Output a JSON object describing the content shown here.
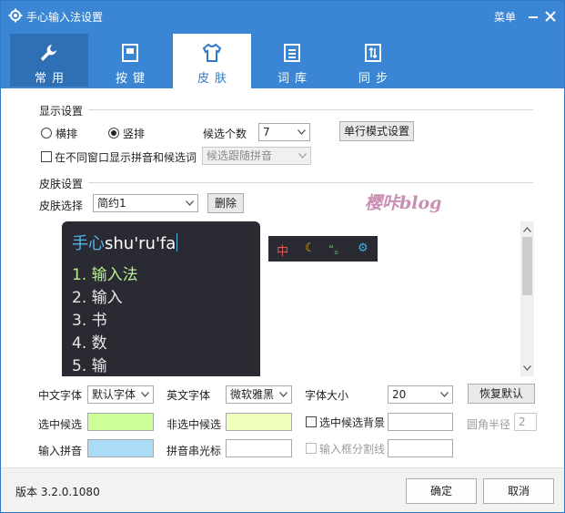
{
  "window": {
    "title": "手心输入法设置",
    "menu_label": "菜单"
  },
  "tabs": [
    {
      "label": "常用",
      "icon": "wrench-icon"
    },
    {
      "label": "按键",
      "icon": "keyboard-icon"
    },
    {
      "label": "皮肤",
      "icon": "shirt-icon"
    },
    {
      "label": "词库",
      "icon": "document-icon"
    },
    {
      "label": "同步",
      "icon": "sync-icon"
    }
  ],
  "display": {
    "section_title": "显示设置",
    "horizontal_label": "横排",
    "vertical_label": "竖排",
    "candidate_count_label": "候选个数",
    "candidate_count_value": "7",
    "single_line_button": "单行模式设置",
    "separate_window_label": "在不同窗口显示拼音和候选词",
    "follow_pinyin_value": "候选跟随拼音"
  },
  "skin": {
    "section_title": "皮肤设置",
    "select_label": "皮肤选择",
    "select_value": "简约1",
    "delete_button": "删除",
    "watermark": "樱咔blog",
    "preview": {
      "pinyin_hanzi": "手心",
      "pinyin_text": "shu'ru'fa",
      "candidates": [
        "1. 输入法",
        "2. 输入",
        "3. 书",
        "4. 数",
        "5. 输"
      ],
      "status_chars": [
        "中",
        "☾",
        "“。",
        "⚙"
      ]
    }
  },
  "fonts": {
    "cn_font_label": "中文字体",
    "cn_font_value": "默认字体",
    "en_font_label": "英文字体",
    "en_font_value": "微软雅黑",
    "size_label": "字体大小",
    "size_value": "20",
    "restore_button": "恢复默认"
  },
  "colors": {
    "selected_cand_label": "选中候选",
    "selected_cand_color": "#ccff99",
    "unselected_cand_label": "非选中候选",
    "unselected_cand_color": "#eeffbb",
    "selected_bg_label": "选中候选背景",
    "corner_radius_label": "圆角半径",
    "corner_radius_value": "2",
    "input_pinyin_label": "输入拼音",
    "input_pinyin_color": "#aaddf5",
    "caret_label": "拼音串光标",
    "input_divider_label": "输入框分割线"
  },
  "footer": {
    "version": "版本 3.2.0.1080",
    "ok_button": "确定",
    "cancel_button": "取消"
  },
  "theme": {
    "accent": "#3a86d4",
    "tab_dark": "#2f6fb4",
    "preview_bg": "#2a2a33"
  }
}
